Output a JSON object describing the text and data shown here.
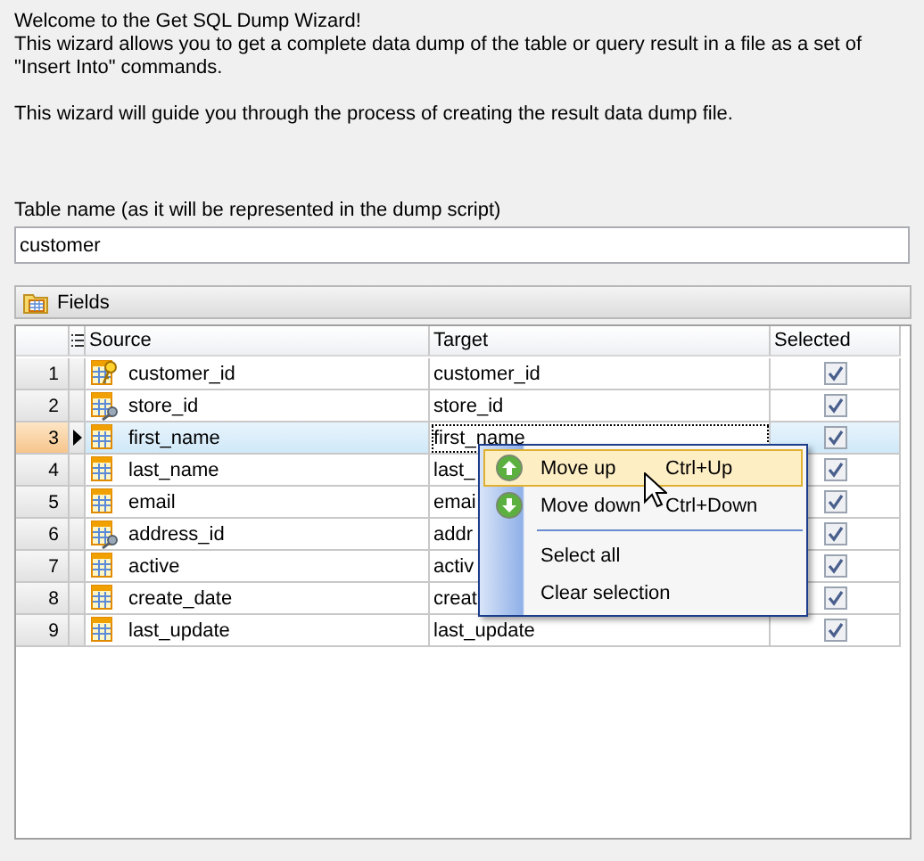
{
  "intro": {
    "title": "Welcome to the Get SQL Dump Wizard!",
    "description": "This wizard allows you to get a complete data dump of the table or query result in a file as a set of \"Insert Into\" commands.",
    "guide": "This wizard will guide you through the process of creating the result data dump file."
  },
  "table_name": {
    "label": "Table name (as it will be represented in the dump script)",
    "value": "customer"
  },
  "fields_panel": {
    "title": "Fields"
  },
  "grid": {
    "columns": [
      "Source",
      "Target",
      "Selected"
    ],
    "rows": [
      {
        "number": "1",
        "kind": "primary-key",
        "source": "customer_id",
        "target": "customer_id",
        "checked": true,
        "focused": false
      },
      {
        "number": "2",
        "kind": "foreign-key",
        "source": "store_id",
        "target": "store_id",
        "checked": true,
        "focused": false
      },
      {
        "number": "3",
        "kind": "column",
        "source": "first_name",
        "target": "first_name",
        "checked": true,
        "focused": true
      },
      {
        "number": "4",
        "kind": "column",
        "source": "last_name",
        "target": "last_",
        "checked": true,
        "focused": false
      },
      {
        "number": "5",
        "kind": "column",
        "source": "email",
        "target": "emai",
        "checked": true,
        "focused": false
      },
      {
        "number": "6",
        "kind": "foreign-key",
        "source": "address_id",
        "target": "addr",
        "checked": true,
        "focused": false
      },
      {
        "number": "7",
        "kind": "column",
        "source": "active",
        "target": "activ",
        "checked": true,
        "focused": false
      },
      {
        "number": "8",
        "kind": "column",
        "source": "create_date",
        "target": "creat",
        "checked": true,
        "focused": false
      },
      {
        "number": "9",
        "kind": "column",
        "source": "last_update",
        "target": "last_update",
        "checked": true,
        "focused": false
      }
    ]
  },
  "context_menu": {
    "items": [
      {
        "kind": "arrow-up",
        "label": "Move up",
        "shortcut": "Ctrl+Up",
        "selected": true,
        "separator_after": false
      },
      {
        "kind": "arrow-down",
        "label": "Move down",
        "shortcut": "Ctrl+Down",
        "selected": false,
        "separator_after": true
      },
      {
        "kind": "plain",
        "label": "Select all",
        "selected": false,
        "separator_after": false
      },
      {
        "kind": "plain",
        "label": "Clear selection",
        "selected": false,
        "separator_after": false
      }
    ]
  }
}
